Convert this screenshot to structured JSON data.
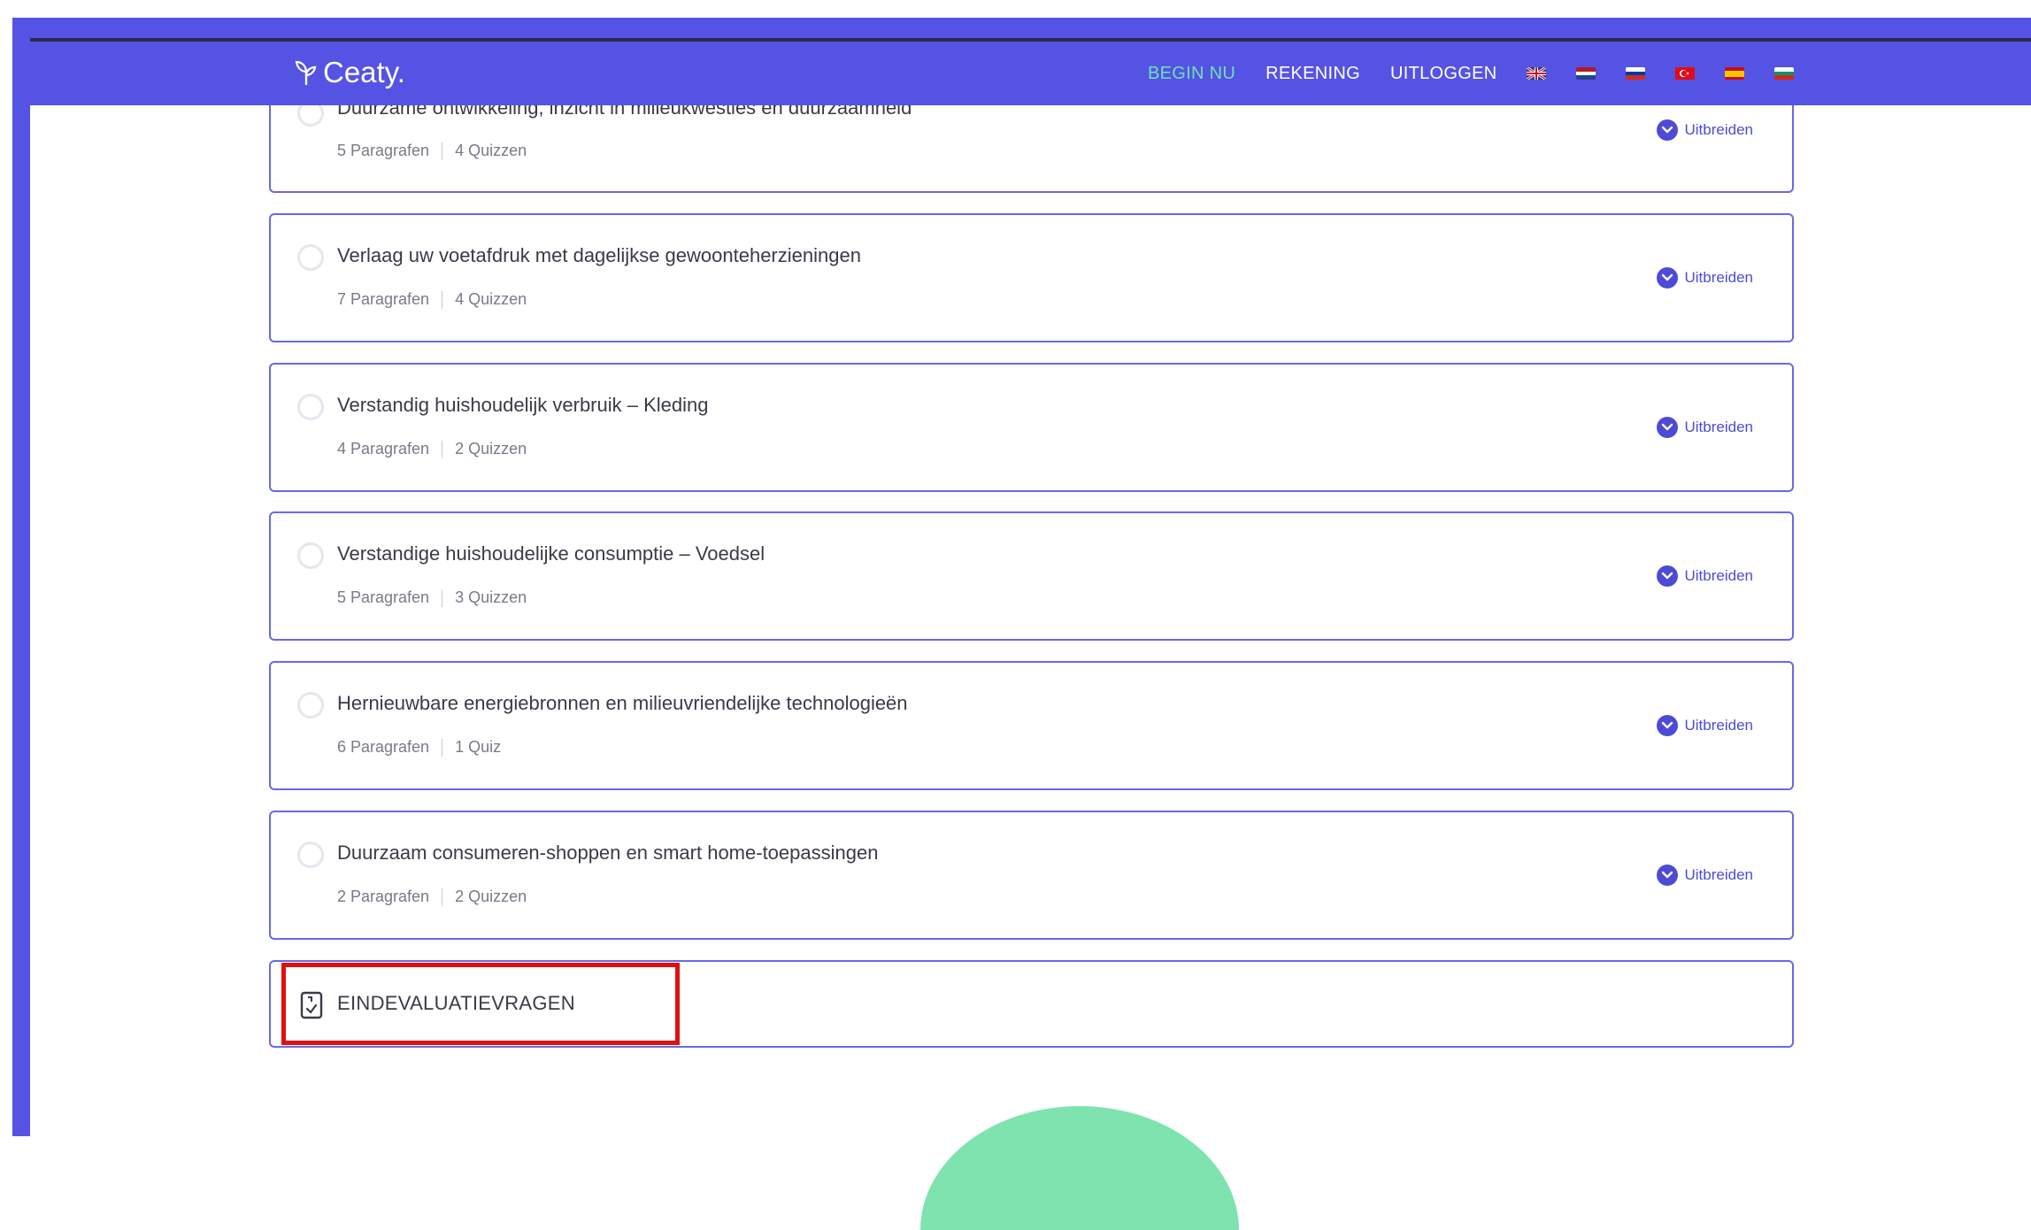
{
  "brand": {
    "name": "Ceaty."
  },
  "nav": {
    "links": [
      "BEGIN NU",
      "REKENING",
      "UITLOGGEN"
    ],
    "active_color": "#6ee0b8",
    "bar_color": "#5553e3",
    "flags": [
      "english-flag",
      "dutch-flag",
      "russian-flag",
      "turkish-flag",
      "spanish-flag",
      "bulgarian-flag"
    ]
  },
  "lessons": [
    {
      "title": "Duurzame ontwikkeling, inzicht in milieukwesties en duurzaamheid",
      "paragraphs": "5 Paragrafen",
      "quizzes": "4 Quizzen",
      "expand": "Uitbreiden"
    },
    {
      "title": "Verlaag uw voetafdruk met dagelijkse gewoonteherzieningen",
      "paragraphs": "7 Paragrafen",
      "quizzes": "4 Quizzen",
      "expand": "Uitbreiden"
    },
    {
      "title": "Verstandig huishoudelijk verbruik – Kleding",
      "paragraphs": "4 Paragrafen",
      "quizzes": "2 Quizzen",
      "expand": "Uitbreiden"
    },
    {
      "title": "Verstandige huishoudelijke consumptie – Voedsel",
      "paragraphs": "5 Paragrafen",
      "quizzes": "3 Quizzen",
      "expand": "Uitbreiden"
    },
    {
      "title": "Hernieuwbare energiebronnen en milieuvriendelijke technologieën",
      "paragraphs": "6 Paragrafen",
      "quizzes": "1 Quiz",
      "expand": "Uitbreiden"
    },
    {
      "title": "Duurzaam consumeren-shoppen en smart home-toepassingen",
      "paragraphs": "2 Paragrafen",
      "quizzes": "2 Quizzen",
      "expand": "Uitbreiden"
    }
  ],
  "final_quiz": {
    "title": "EINDEVALUATIEVRAGEN"
  },
  "colors": {
    "accent": "#4d4bd6",
    "card_border": "#6a68e6",
    "highlight": "#e01010"
  }
}
